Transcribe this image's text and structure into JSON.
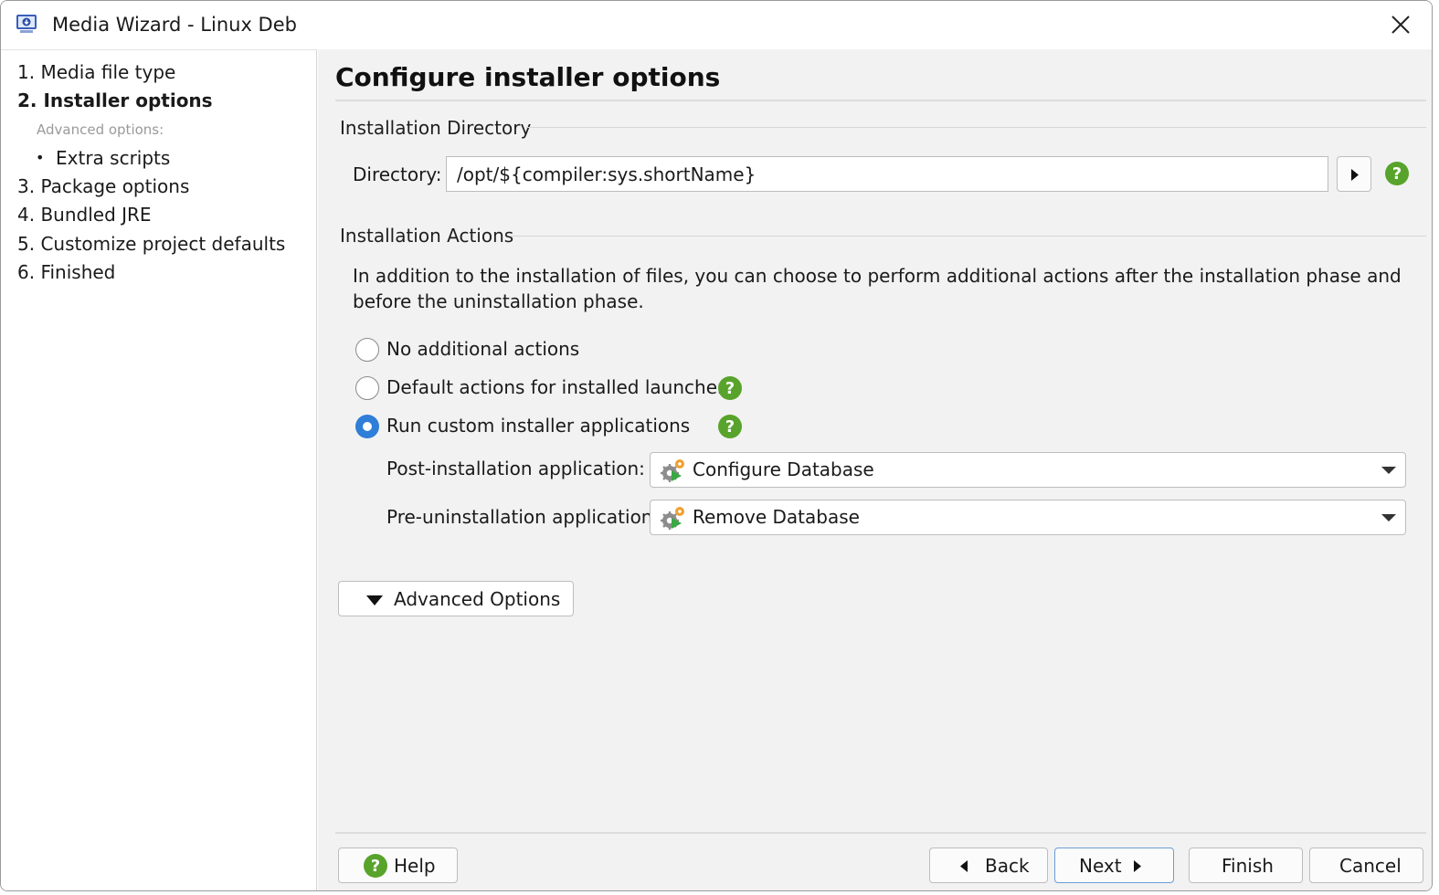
{
  "window": {
    "title": "Media Wizard - Linux Deb",
    "app_icon": "installer-app-icon",
    "close_icon": "close-icon"
  },
  "sidebar": {
    "steps": [
      {
        "label": "1. Media file type"
      },
      {
        "label": "2. Installer options",
        "active": true
      },
      {
        "label": "3. Package options"
      },
      {
        "label": "4. Bundled JRE"
      },
      {
        "label": "5. Customize project defaults"
      },
      {
        "label": "6. Finished"
      }
    ],
    "advanced_label": "Advanced options:",
    "bullet": "•",
    "extra_scripts": "Extra scripts"
  },
  "page": {
    "title": "Configure installer options"
  },
  "install_dir": {
    "section_title": "Installation Directory",
    "label": "Directory:",
    "value": "/opt/${compiler:sys.shortName}"
  },
  "install_actions": {
    "section_title": "Installation Actions",
    "description": "In addition to the installation of files, you can choose to perform additional actions after the installation phase and before the uninstallation phase.",
    "options": [
      {
        "label": "No additional actions",
        "checked": false
      },
      {
        "label": "Default actions for installed launchers",
        "checked": false
      },
      {
        "label": "Run custom installer applications",
        "checked": true
      }
    ],
    "post_install_label": "Post-installation application:",
    "post_install_value": "Configure Database",
    "pre_uninstall_label": "Pre-uninstallation application:",
    "pre_uninstall_value": "Remove Database"
  },
  "advanced_button": "Advanced Options",
  "footer": {
    "help": "Help",
    "back": "Back",
    "next": "Next",
    "finish": "Finish",
    "cancel": "Cancel"
  },
  "colors": {
    "accent": "#2f7ed8",
    "help_green": "#58a32b",
    "panel_bg": "#f2f2f2"
  }
}
